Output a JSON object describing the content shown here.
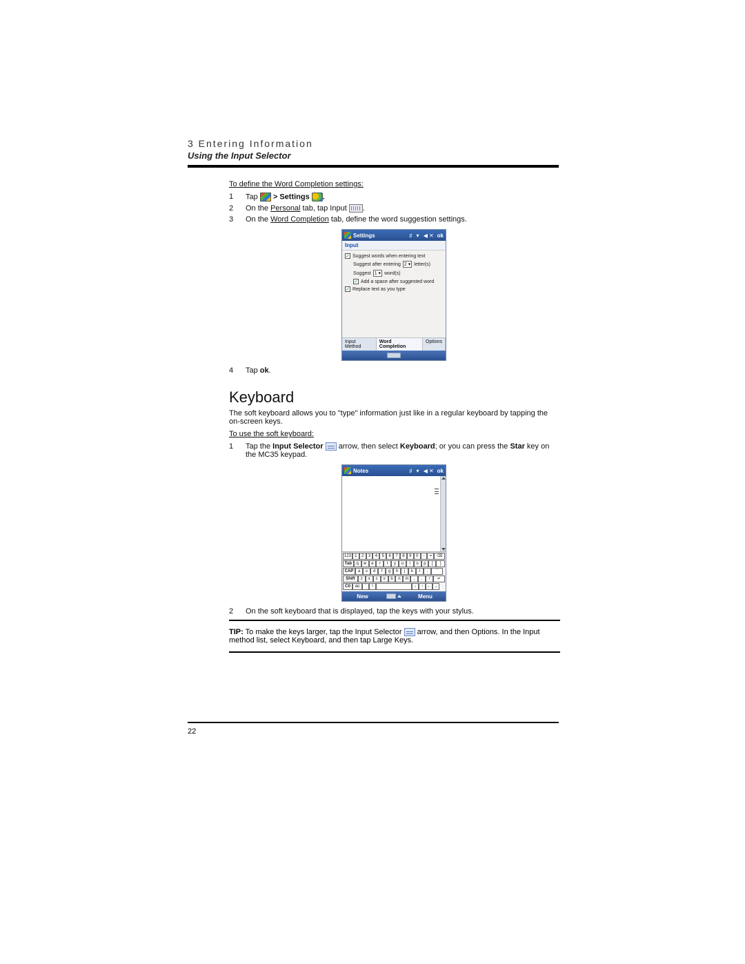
{
  "header": {
    "chapter": "3 Entering Information",
    "section": "Using the Input Selector"
  },
  "procedure1": {
    "title": "To define the Word Completion settings:",
    "steps": [
      {
        "n": "1",
        "pre": "Tap ",
        "bold": " > Settings ",
        "post": "."
      },
      {
        "n": "2",
        "pre": "On the ",
        "u": "Personal",
        "mid": " tab, tap Input ",
        "post": "."
      },
      {
        "n": "3",
        "pre": "On the ",
        "u": "Word Completion",
        "mid": " tab, define the word suggestion settings.",
        "post": ""
      },
      {
        "n": "4",
        "pre": "Tap ",
        "bold2": "ok",
        "post": "."
      }
    ]
  },
  "screenshot1": {
    "titlebar": {
      "title": "Settings",
      "ok": "ok",
      "icons": "♯ ▾ ◀✕"
    },
    "subtitle": "Input",
    "cb1": "Suggest words when entering text",
    "row2a": "Suggest after entering",
    "row2sel": "2",
    "row2b": "letter(s)",
    "row3a": "Suggest",
    "row3sel": "1",
    "row3b": "word(s)",
    "cb4": "Add a space after suggested word",
    "cb5": "Replace text as you type",
    "tabs": [
      "Input Method",
      "Word Completion",
      "Options"
    ]
  },
  "keyboard": {
    "heading": "Keyboard",
    "intro": "The soft keyboard allows you to \"type\" information just like in a regular keyboard by tapping the on-screen keys.",
    "proc_title": "To use the soft keyboard:",
    "step1": {
      "n": "1",
      "t1": "Tap the ",
      "b1": "Input Selector ",
      "t2": " arrow, then select ",
      "b2": "Keyboard",
      "t3": "; or you can press the ",
      "b3": "Star",
      "t4": " key on the MC35 keypad."
    },
    "step2": {
      "n": "2",
      "t": "On the soft keyboard that is displayed, tap the keys with your stylus."
    }
  },
  "screenshot2": {
    "titlebar": {
      "title": "Notes",
      "ok": "ok",
      "icons": "♯ ▾ ◀✕"
    },
    "rows": [
      [
        "123",
        "1",
        "2",
        "3",
        "4",
        "5",
        "6",
        "7",
        "8",
        "9",
        "0",
        "-",
        "=",
        "⌫"
      ],
      [
        "Tab",
        "q",
        "w",
        "e",
        "r",
        "t",
        "y",
        "u",
        "i",
        "o",
        "p",
        "[",
        "]"
      ],
      [
        "CAP",
        "a",
        "s",
        "d",
        "f",
        "g",
        "h",
        "j",
        "k",
        "l",
        ";",
        "'"
      ],
      [
        "Shift",
        "z",
        "x",
        "c",
        "v",
        "b",
        "n",
        "m",
        ",",
        ".",
        "/",
        "↵"
      ],
      [
        "Ctl",
        "áü",
        "`",
        "\\",
        " ",
        " ",
        "↓",
        "↑",
        "←",
        "→"
      ]
    ],
    "bottombar": {
      "left": "New",
      "right": "Menu"
    }
  },
  "tip": {
    "label": "TIP:",
    "t1": "To make the keys larger, tap the ",
    "b1": "Input Selector ",
    "t2": " arrow, and then ",
    "b2": "Options",
    "t3": ". In the Input method list, select ",
    "b3": "Keyboard",
    "t4": ", and then tap ",
    "b4": "Large Keys",
    "t5": "."
  },
  "page_number": "22"
}
